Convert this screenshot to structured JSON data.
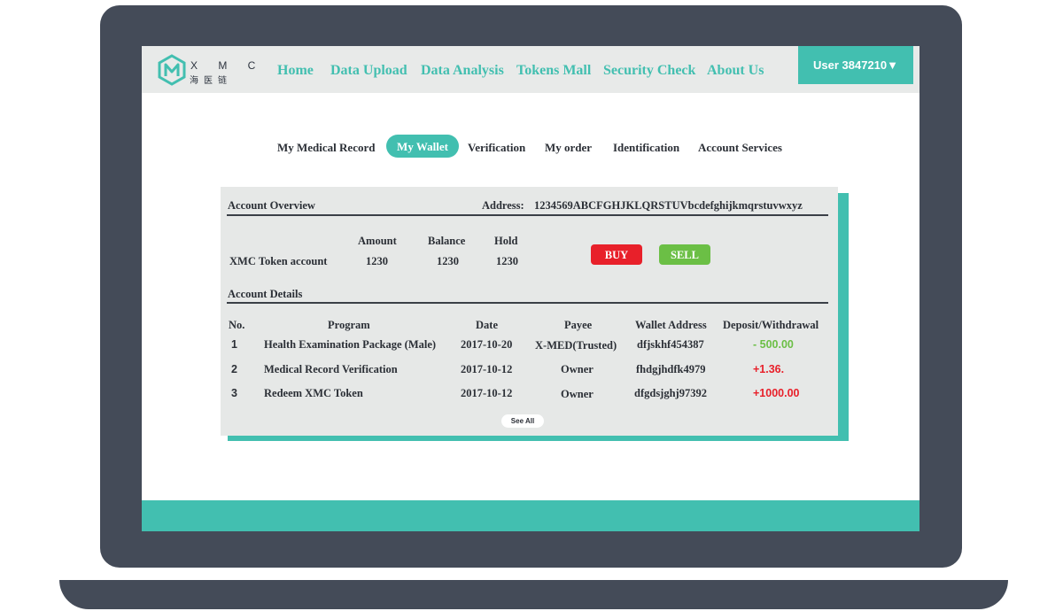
{
  "header": {
    "logo_latin": "X M C",
    "logo_cjk": "海医链",
    "nav": [
      "Home",
      "Data Upload",
      "Data Analysis",
      "Tokens Mall",
      "Security Check",
      "About Us"
    ],
    "user_label": "User 3847210▼"
  },
  "subtabs": {
    "items": [
      "My Medical Record",
      "My Wallet",
      "Verification",
      "My order",
      "Identification",
      "Account Services"
    ],
    "active": "My Wallet"
  },
  "overview": {
    "title": "Account Overview",
    "address_label": "Address:",
    "address_value": "1234569ABCFGHJKLQRSTUVbcdefghijkmqrstuvwxyz",
    "account_name": "XMC Token account",
    "columns": [
      "Amount",
      "Balance",
      "Hold"
    ],
    "values": [
      "1230",
      "1230",
      "1230"
    ],
    "buy_label": "BUY",
    "sell_label": "SELL"
  },
  "details": {
    "title": "Account Details",
    "columns": [
      "No.",
      "Program",
      "Date",
      "Payee",
      "Wallet Address",
      "Deposit/Withdrawal"
    ],
    "rows": [
      {
        "no": "1",
        "program": "Health Examination Package (Male)",
        "date": "2017-10-20",
        "payee": "X-MED(Trusted)",
        "wallet": "dfjskhf454387",
        "amount": "- 500.00"
      },
      {
        "no": "2",
        "program": "Medical Record Verification",
        "date": "2017-10-12",
        "payee": "Owner",
        "wallet": "fhdgjhdfk4979",
        "amount": "+1.36."
      },
      {
        "no": "3",
        "program": "Redeem XMC Token",
        "date": "2017-10-12",
        "payee": "Owner",
        "wallet": "dfgdsjghj97392",
        "amount": "+1000.00"
      }
    ],
    "see_all": "See All"
  },
  "colors": {
    "accent": "#42bfb0",
    "frame": "#444b58",
    "buy": "#e8202a",
    "sell": "#6bbf45",
    "withdrawal": "#6bbf45",
    "deposit": "#e8202a"
  }
}
